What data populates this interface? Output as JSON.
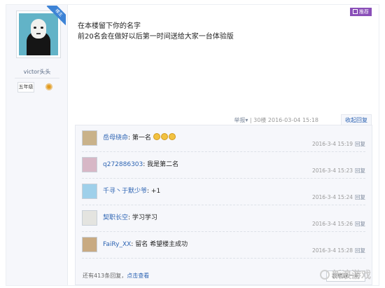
{
  "author": {
    "badge": "楼主",
    "name": "victor头头",
    "level": "五年级"
  },
  "post": {
    "recommend_label": "推荐",
    "content_lines": [
      "在本楼留下你的名字",
      "前20名会在做好以后第一时间送给大家一台体验版"
    ],
    "report": "举报",
    "floor": "30楼",
    "time": "2016-03-04 15:18",
    "collapse_label": "收起回复"
  },
  "comments": [
    {
      "user": "岳母绕命",
      "sep": ":",
      "text": " 第一名",
      "faces": 3,
      "time": "2016-3-4 15:19",
      "reply": "回复"
    },
    {
      "user": "q272886303",
      "sep": ":",
      "text": " 我是第二名",
      "faces": 0,
      "time": "2016-3-4 15:23",
      "reply": "回复"
    },
    {
      "user": "千寻丶于默少爷",
      "sep": ":",
      "text": " +1",
      "faces": 0,
      "time": "2016-3-4 15:24",
      "reply": "回复"
    },
    {
      "user": "契职长空",
      "sep": ":",
      "text": " 学习学习",
      "faces": 0,
      "time": "2016-3-4 15:26",
      "reply": "回复"
    },
    {
      "user": "FaiRy_XX",
      "sep": ":",
      "text": " 留名 希望楼主成功",
      "faces": 0,
      "time": "2016-3-4 15:28",
      "reply": "回复"
    }
  ],
  "footer": {
    "more_prefix": "还有413条回复，",
    "more_link": "点击查看",
    "i_say": "我也说一句",
    "watermark": "新浪游戏"
  },
  "icons": {
    "level": "sun-badge-icon",
    "smiley": "smiley-face-icon",
    "recommend": "recommend-icon",
    "watermark_logo": "sina-eye-icon"
  },
  "colors": {
    "link_blue": "#2d64b3",
    "badge_blue": "#3d83d6",
    "recommend_purple": "#8a4fb8"
  }
}
